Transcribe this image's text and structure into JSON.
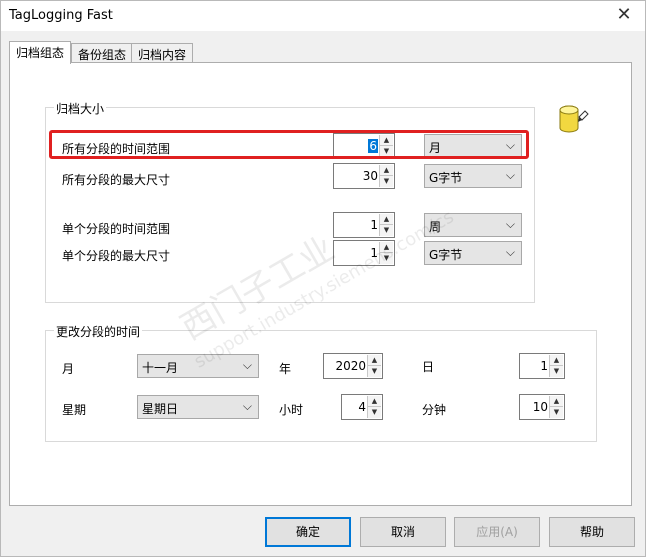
{
  "window": {
    "title": "TagLogging Fast",
    "close_glyph": "✕"
  },
  "tabs": [
    {
      "label": "归档组态"
    },
    {
      "label": "备份组态"
    },
    {
      "label": "归档内容"
    }
  ],
  "archive_size": {
    "title": "归档大小",
    "rows": [
      {
        "label": "所有分段的时间范围",
        "value": "6",
        "unit": "月"
      },
      {
        "label": "所有分段的最大尺寸",
        "value": "30",
        "unit": "G字节"
      },
      {
        "label": "单个分段的时间范围",
        "value": "1",
        "unit": "周"
      },
      {
        "label": "单个分段的最大尺寸",
        "value": "1",
        "unit": "G字节"
      }
    ]
  },
  "change_time": {
    "title": "更改分段的时间",
    "month_label": "月",
    "month_value": "十一月",
    "year_label": "年",
    "year_value": "2020",
    "day_label": "日",
    "day_value": "1",
    "weekday_label": "星期",
    "weekday_value": "星期日",
    "hour_label": "小时",
    "hour_value": "4",
    "minute_label": "分钟",
    "minute_value": "10"
  },
  "buttons": {
    "ok": "确定",
    "cancel": "取消",
    "apply": "应用(A)",
    "help": "帮助"
  },
  "watermark": {
    "line1": "西门子工业",
    "line2": "support.industry.siemens.com/cs"
  },
  "icons": {
    "db_icon": "database-edit-icon",
    "spin_up": "▲",
    "spin_down": "▼",
    "chevron": "⌵"
  }
}
